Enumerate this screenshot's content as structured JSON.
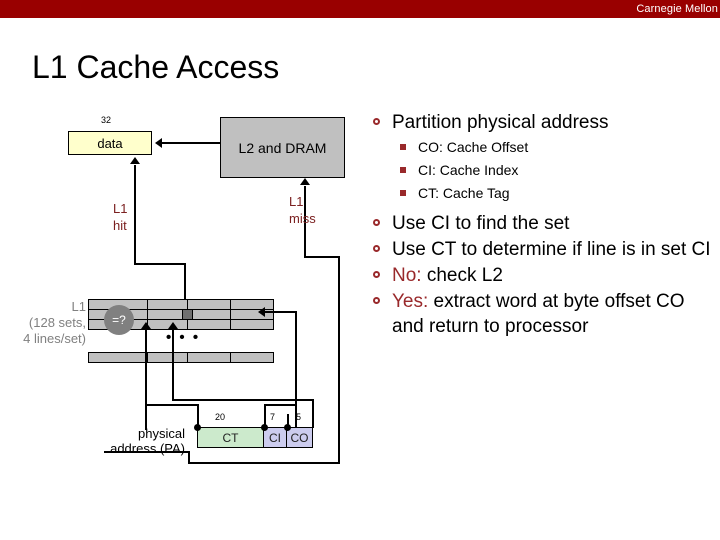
{
  "brand": {
    "text": "Carnegie Mellon"
  },
  "slide": {
    "title": "L1 Cache Access"
  },
  "bullets": [
    {
      "level": 1,
      "text": "Partition physical address",
      "marker": "hollow-circle-bullet"
    },
    {
      "level": 2,
      "text": "CO: Cache Offset",
      "marker": "square-bullet"
    },
    {
      "level": 2,
      "text": "CI: Cache Index",
      "marker": "square-bullet"
    },
    {
      "level": 2,
      "text": "CT: Cache Tag",
      "marker": "square-bullet"
    },
    {
      "level": 1,
      "text": "Use CI to find the set",
      "marker": "hollow-circle-bullet"
    },
    {
      "level": 1,
      "text": "Use CT to determine if line is in set CI",
      "marker": "hollow-circle-bullet"
    },
    {
      "level": 1,
      "keyword": "No:",
      "text": " check L2",
      "marker": "hollow-circle-bullet"
    },
    {
      "level": 1,
      "keyword": "Yes:",
      "text": " extract word at byte offset CO and return to processor",
      "marker": "hollow-circle-bullet"
    }
  ],
  "diagram": {
    "data_box": {
      "label": "data",
      "bit_width": "32"
    },
    "memory_box": {
      "label": "L2 and DRAM"
    },
    "hit_path": {
      "line1": "L1",
      "line2": "hit"
    },
    "miss_path": {
      "line1": "L1",
      "line2": "miss"
    },
    "cache": {
      "label_line1": "L1",
      "label_line2": "(128 sets,",
      "label_line3": "4 lines/set)",
      "compare_label": "=?",
      "ellipsis": "• • •"
    },
    "address": {
      "label_line1": "physical",
      "label_line2": "address (PA)",
      "segments": [
        {
          "name": "CT",
          "bits": "20"
        },
        {
          "name": "CI",
          "bits": "7"
        },
        {
          "name": "CO",
          "bits": "5"
        }
      ]
    }
  },
  "colors": {
    "brand_bar": "#990000",
    "accent_red": "#99292b",
    "annotation_red": "#7b2020",
    "data_box_fill": "#ffffcc",
    "memory_box_fill": "#c0c0c0",
    "cache_cell_fill": "#c0c0c0",
    "cache_cell_selected": "#707070",
    "tag_segment_fill": "#cceacc",
    "index_offset_segment_fill": "#ccccee",
    "muted_gray": "#808080"
  }
}
